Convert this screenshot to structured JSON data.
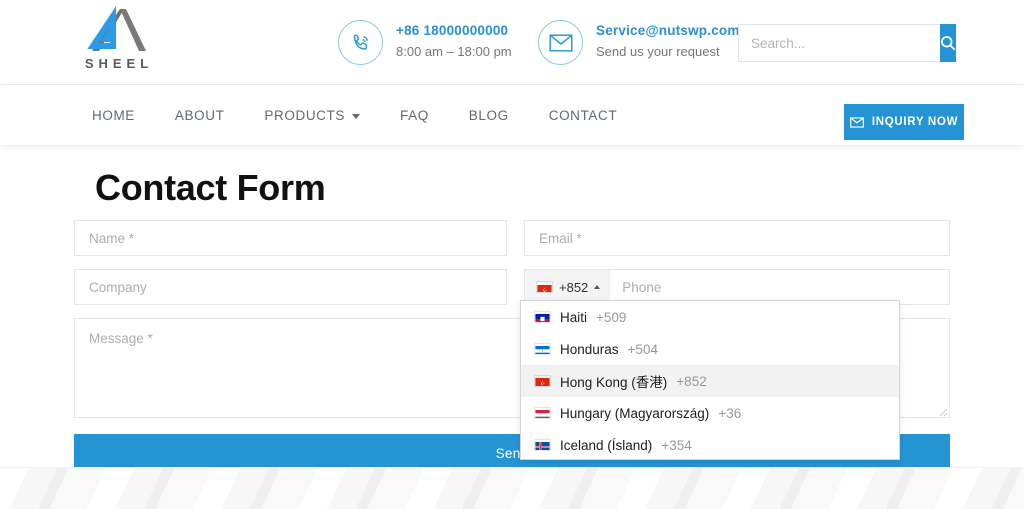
{
  "brand": {
    "logo_text": "SHEEL",
    "logo_blue": "#2b9ae8",
    "logo_gray": "#6e6e6e",
    "accent": "#2494d4"
  },
  "header": {
    "phone": {
      "icon": "phone-ring-icon",
      "number": "+86 18000000000",
      "hours": "8:00 am – 18:00 pm"
    },
    "email": {
      "icon": "envelope-icon",
      "address": "Service@nutswp.com",
      "tagline": "Send us your request"
    },
    "search": {
      "placeholder": "Search...",
      "value": "",
      "button_icon": "search-icon"
    }
  },
  "nav": {
    "items": [
      {
        "label": "HOME",
        "has_caret": false
      },
      {
        "label": "ABOUT",
        "has_caret": false
      },
      {
        "label": "PRODUCTS",
        "has_caret": true
      },
      {
        "label": "FAQ",
        "has_caret": false
      },
      {
        "label": "BLOG",
        "has_caret": false
      },
      {
        "label": "CONTACT",
        "has_caret": false
      }
    ],
    "inquiry_button": {
      "label": "INQUIRY NOW",
      "icon": "envelope-icon"
    }
  },
  "main": {
    "title": "Contact Form",
    "fields": {
      "name": {
        "placeholder": "Name *",
        "value": ""
      },
      "email": {
        "placeholder": "Email *",
        "value": ""
      },
      "company": {
        "placeholder": "Company",
        "value": ""
      },
      "phone": {
        "placeholder": "Phone",
        "value": ""
      },
      "message": {
        "placeholder": "Message *",
        "value": ""
      }
    },
    "selected_country": {
      "flag": "hong-kong-flag",
      "dial_code": "+852",
      "arrow": "caret-up-icon"
    },
    "send_button": {
      "label": "Send"
    }
  },
  "country_dropdown": {
    "open": true,
    "items": [
      {
        "name": "Haiti",
        "code": "+509",
        "flag": "haiti-flag",
        "highlight": false
      },
      {
        "name": "Honduras",
        "code": "+504",
        "flag": "honduras-flag",
        "highlight": false
      },
      {
        "name": "Hong Kong (香港)",
        "code": "+852",
        "flag": "hong-kong-flag",
        "highlight": true
      },
      {
        "name": "Hungary (Magyarország)",
        "code": "+36",
        "flag": "hungary-flag",
        "highlight": false
      },
      {
        "name": "Iceland (Ísland)",
        "code": "+354",
        "flag": "iceland-flag",
        "highlight": false
      }
    ]
  }
}
